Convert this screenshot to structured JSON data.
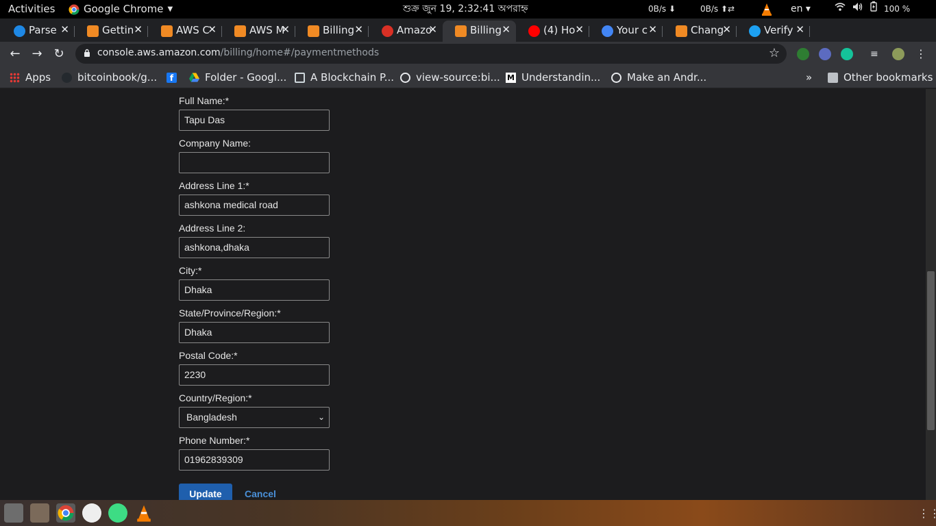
{
  "topbar": {
    "activities": "Activities",
    "app_name": "Google Chrome",
    "clock": "শুক্র জুন 19,  2:32:41 অপরাহ্ন",
    "net_down": "0B/s ⬇",
    "net_up": "0B/s ⬆⇄",
    "lang": "en ▾",
    "battery": "100 %"
  },
  "tabs": [
    {
      "label": "Parse",
      "icon": "parse-icon",
      "color": "#1e88e5"
    },
    {
      "label": "Gettin",
      "icon": "aws-icon",
      "color": "#f08a24"
    },
    {
      "label": "AWS C",
      "icon": "aws-icon",
      "color": "#f08a24"
    },
    {
      "label": "AWS M",
      "icon": "aws-icon",
      "color": "#f08a24"
    },
    {
      "label": "Billing",
      "icon": "aws-icon",
      "color": "#f08a24"
    },
    {
      "label": "Amazo",
      "icon": "gmail-icon",
      "color": "#d93025"
    },
    {
      "label": "Billing",
      "icon": "aws-icon",
      "color": "#f08a24"
    },
    {
      "label": "(4) Ho",
      "icon": "youtube-icon",
      "color": "#ff0000"
    },
    {
      "label": "Your c",
      "icon": "google-icon",
      "color": "#4285f4"
    },
    {
      "label": "Chang",
      "icon": "aws-icon",
      "color": "#f08a24"
    },
    {
      "label": "Verify",
      "icon": "verify-icon",
      "color": "#1da1f2"
    }
  ],
  "active_tab_index": 6,
  "omnibox": {
    "host": "console.aws.amazon.com",
    "path": "/billing/home#/paymentmethods"
  },
  "bookmarks": [
    {
      "label": "Apps",
      "icon": "apps-grid-icon"
    },
    {
      "label": "bitcoinbook/g...",
      "icon": "github-icon"
    },
    {
      "label": "",
      "icon": "facebook-icon"
    },
    {
      "label": "Folder - Googl...",
      "icon": "google-drive-icon"
    },
    {
      "label": "A Blockchain P...",
      "icon": "book-icon"
    },
    {
      "label": "view-source:bi...",
      "icon": "globe-icon"
    },
    {
      "label": "Understandin...",
      "icon": "medium-icon"
    },
    {
      "label": "Make an Andr...",
      "icon": "globe-icon"
    }
  ],
  "bookmarks_overflow": "»",
  "other_bookmarks": "Other bookmarks",
  "form": {
    "full_name": {
      "label": "Full Name:*",
      "value": "Tapu Das"
    },
    "company_name": {
      "label": "Company Name:",
      "value": ""
    },
    "address1": {
      "label": "Address Line 1:*",
      "value": "ashkona medical road"
    },
    "address2": {
      "label": "Address Line 2:",
      "value": "ashkona,dhaka"
    },
    "city": {
      "label": "City:*",
      "value": "Dhaka"
    },
    "state": {
      "label": "State/Province/Region:*",
      "value": "Dhaka"
    },
    "postal": {
      "label": "Postal Code:*",
      "value": "2230"
    },
    "country": {
      "label": "Country/Region:*",
      "value": "Bangladesh"
    },
    "phone": {
      "label": "Phone Number:*",
      "value": "01962839309"
    },
    "update_label": "Update",
    "cancel_label": "Cancel"
  },
  "colors": {
    "page_bg": "#1c1c1e",
    "primary_button": "#1f5fad",
    "link": "#4a90d9"
  }
}
